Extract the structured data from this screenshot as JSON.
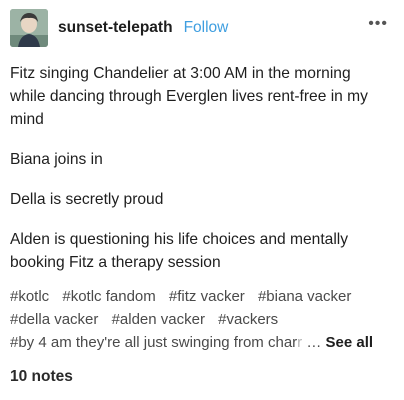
{
  "header": {
    "username": "sunset-telepath",
    "follow_label": "Follow",
    "more_label": "•••"
  },
  "post": {
    "paragraphs": [
      "Fitz singing Chandelier at 3:00 AM in the morning while dancing through Everglen lives rent-free in my mind",
      "Biana joins in",
      "Della is secretly proud",
      "Alden is questioning his life choices and mentally booking Fitz a therapy session"
    ]
  },
  "tags": {
    "line1": [
      "#kotlc",
      "#kotlc fandom",
      "#fitz vacker",
      "#biana vacker"
    ],
    "line2": [
      "#della vacker",
      "#alden vacker",
      "#vackers"
    ],
    "line3_visible": "#by 4 am they're all just swinging from char",
    "line3_faded": "r",
    "ellipsis": "…",
    "see_all_label": "See all"
  },
  "notes": {
    "label": "10 notes"
  },
  "colors": {
    "follow": "#3e9ee0",
    "text": "#1e1e1e",
    "tag": "#4a4a4a"
  }
}
